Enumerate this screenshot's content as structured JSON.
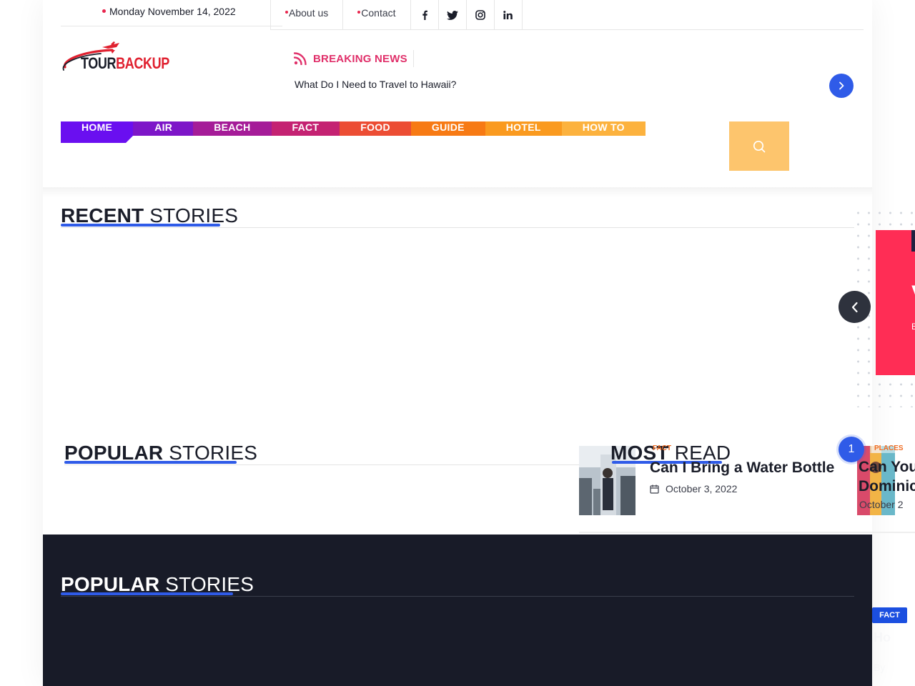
{
  "topbar": {
    "date": "Monday November 14, 2022",
    "links": [
      {
        "label": "About us"
      },
      {
        "label": "Contact"
      }
    ],
    "social": [
      "facebook-icon",
      "twitter-icon",
      "instagram-icon",
      "linkedin-icon"
    ]
  },
  "logo": {
    "part1": "TOUR",
    "part2": "BACKUP"
  },
  "breaking": {
    "title": "BREAKING NEWS",
    "headline": "What Do I Need to Travel to Hawaii?"
  },
  "menu": [
    {
      "label": "HOME",
      "color": "#6a0ff0"
    },
    {
      "label": "AIR",
      "color": "#7d16c8"
    },
    {
      "label": "BEACH",
      "color": "#a51c98"
    },
    {
      "label": "FACT",
      "color": "#c42272"
    },
    {
      "label": "FOOD",
      "color": "#ec4d34"
    },
    {
      "label": "GUIDE",
      "color": "#f77a14"
    },
    {
      "label": "HOTEL",
      "color": "#fa9a1f"
    },
    {
      "label": "HOW TO",
      "color": "#fcb23e"
    }
  ],
  "sections": {
    "recent": {
      "bold": "RECENT",
      "light": " STORIES"
    },
    "popular": {
      "bold": "POPULAR",
      "light": " STORIES"
    },
    "most_read": {
      "bold": "MOST",
      "light": " READ"
    },
    "popular_dark": {
      "bold": "POPULAR",
      "light": " STORIES"
    }
  },
  "most_read": [
    {
      "tag": "FACT",
      "title": "Can I Bring a Water Bottle",
      "date": "October 3, 2022"
    },
    {
      "rank": "1",
      "tag": "PLACES",
      "title_line1": "Can You",
      "title_line2": "Dominic",
      "date": "October 2"
    }
  ],
  "dark_section": {
    "badge": "FACT",
    "ghost1": "Ho",
    "ghost2": "By"
  },
  "colors": {
    "accent": "#2f5be8",
    "breaking": "#e0306a",
    "dark_bg": "#181b28",
    "search_bg": "#fdc56d"
  }
}
